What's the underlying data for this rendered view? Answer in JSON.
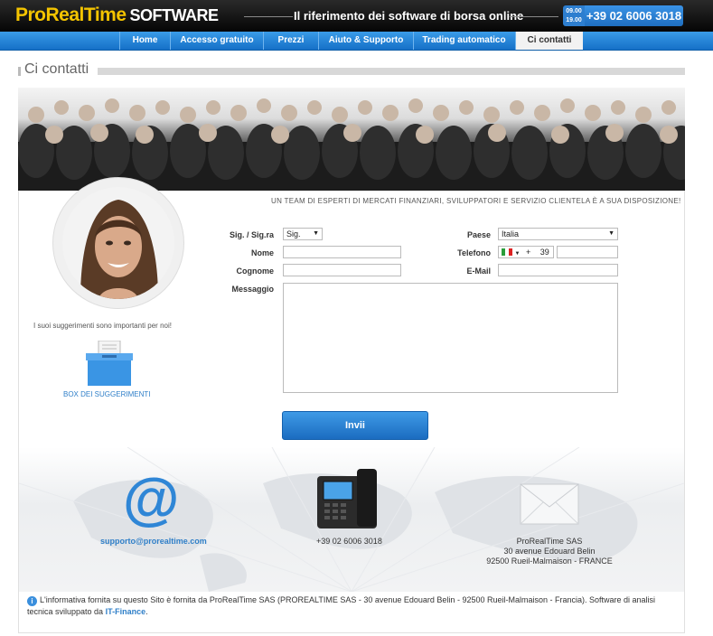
{
  "brand": {
    "name": "ProRealTime",
    "suffix": "SOFTWARE",
    "tagline": "Il riferimento dei software di borsa online"
  },
  "contact_header": {
    "hours_open": "09.00",
    "hours_close": "19.00",
    "phone": "+39 02 6006 3018"
  },
  "nav": [
    "Home",
    "Accesso gratuito",
    "Prezzi",
    "Aiuto & Supporto",
    "Trading automatico",
    "Ci contatti"
  ],
  "page_title": "Ci contatti",
  "strapline": "UN TEAM DI ESPERTI DI MERCATI FINANZIARI, SVILUPPATORI E SERVIZIO CLIENTELA È A SUA DISPOSIZIONE!",
  "sidebar": {
    "suggestion_text": "I suoi suggerimenti sono importanti per noi!",
    "box_label": "BOX DEI SUGGERIMENTI"
  },
  "form": {
    "title_label": "Sig. / Sig.ra",
    "title_value": "Sig.",
    "first_name_label": "Nome",
    "last_name_label": "Cognome",
    "message_label": "Messaggio",
    "country_label": "Paese",
    "country_value": "Italia",
    "phone_label": "Telefono",
    "phone_prefix": "+",
    "phone_code": "39",
    "email_label": "E-Mail",
    "submit_label": "Invii"
  },
  "contacts": {
    "email": "supporto@prorealtime.com",
    "phone": "+39 02 6006 3018",
    "address_lines": [
      "ProRealTime SAS",
      "30 avenue Edouard Belin",
      "92500 Rueil-Malmaison - FRANCE"
    ]
  },
  "footer": {
    "text": "L'informativa fornita su questo Sito è fornita da ProRealTime SAS (PROREALTIME SAS - 30 avenue Edouard Belin - 92500 Rueil-Malmaison - Francia). Software di analisi tecnica sviluppato da",
    "link": "IT-Finance",
    "end": "."
  },
  "colors": {
    "accent": "#2f7fc8",
    "brand_yellow": "#f4c400"
  }
}
